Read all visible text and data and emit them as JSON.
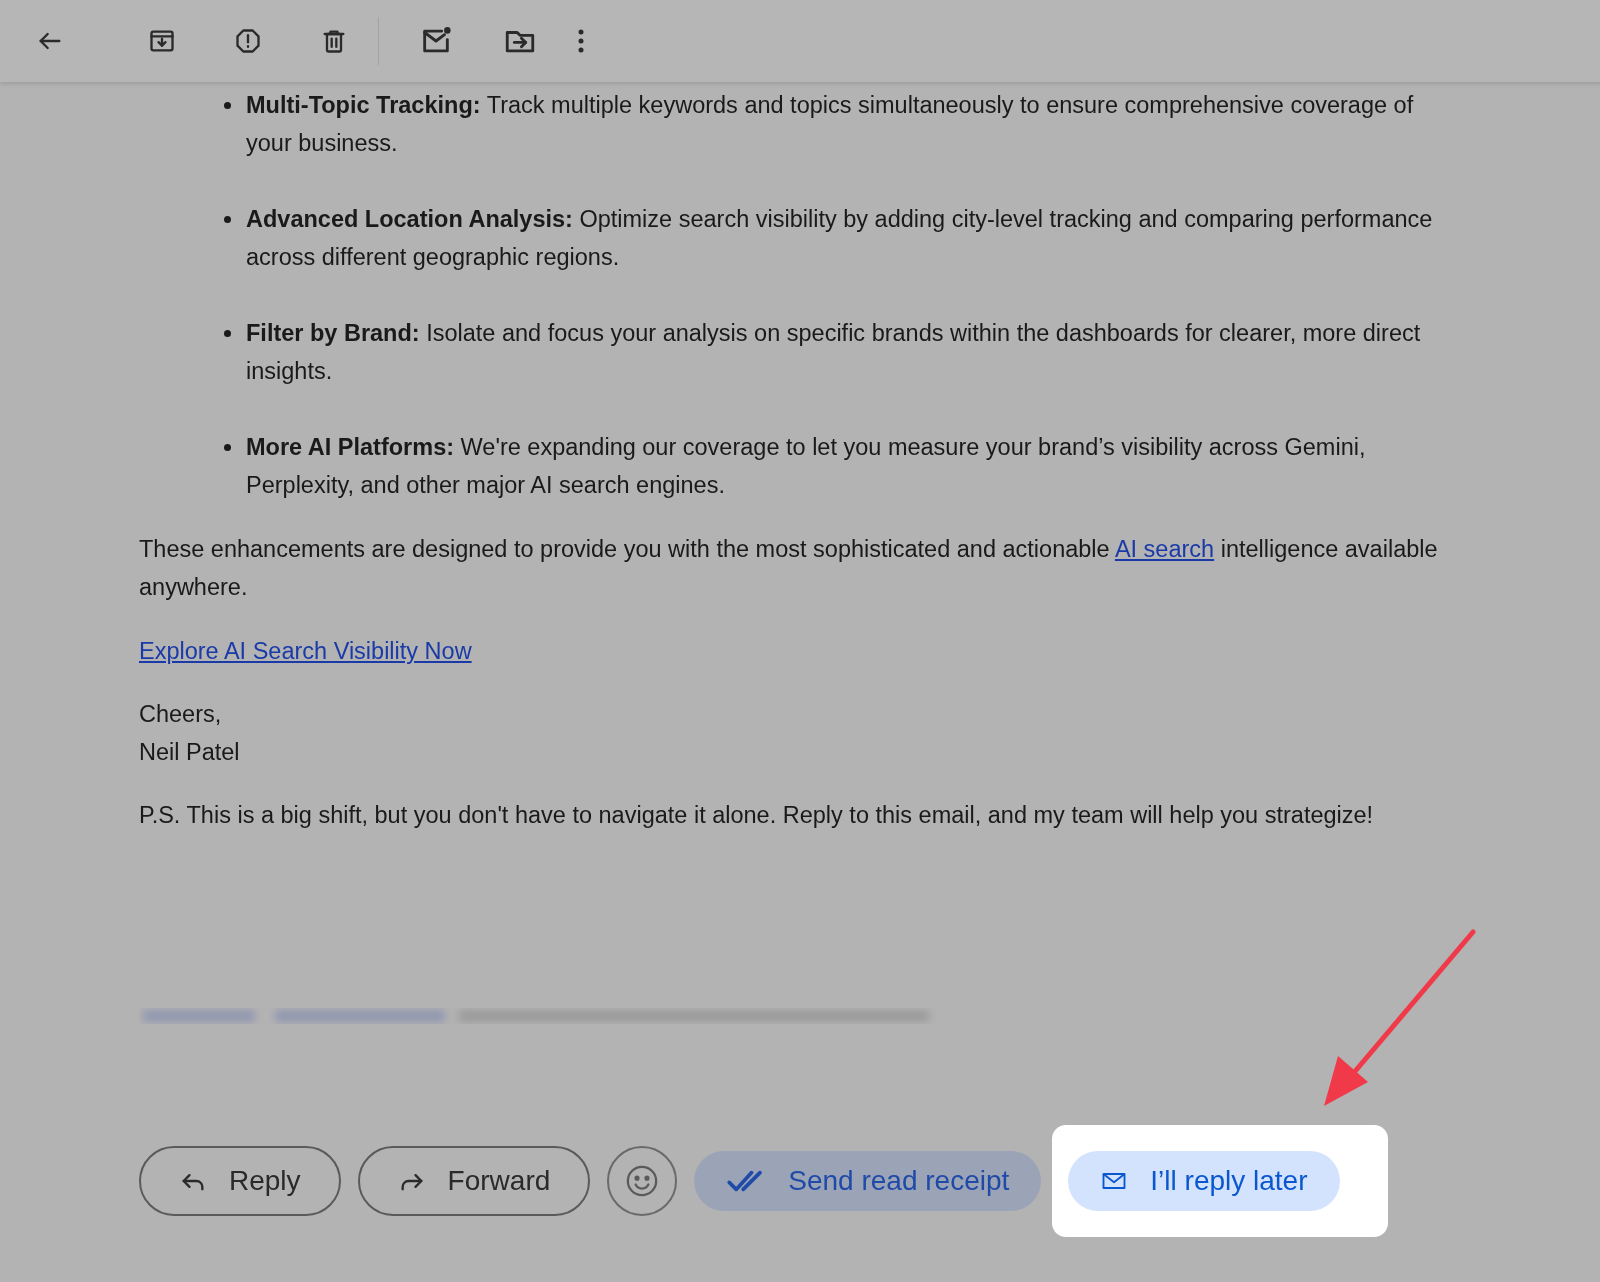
{
  "bullets": [
    {
      "title": "Multi-Topic Tracking:",
      "text": "Track multiple keywords and topics simultaneously to ensure comprehensive coverage of your business."
    },
    {
      "title": "Advanced Location Analysis:",
      "text": "Optimize search visibility by adding city-level tracking and comparing performance across different geographic regions."
    },
    {
      "title": "Filter by Brand:",
      "text": "Isolate and focus your analysis on specific brands within the dashboards for clearer, more direct insights."
    },
    {
      "title": "More AI Platforms:",
      "text": "We're expanding our coverage to let you measure your brand’s visibility across Gemini, Perplexity, and other major AI search engines."
    }
  ],
  "paragraph": {
    "before": "These enhancements are designed to provide you with the most sophisticated and actionable",
    "link": "AI search",
    "after": "intelligence available anywhere."
  },
  "cta_link": "Explore AI Search Visibility Now",
  "signoff": [
    "Cheers,",
    "Neil Patel"
  ],
  "postscript": "P.S. This is a big shift, but you don't have to navigate it alone. Reply to this email, and my team will help you strategize!",
  "actions": [
    {
      "kind": "reply",
      "label": "Reply"
    },
    {
      "kind": "forward",
      "label": "Forward"
    },
    {
      "kind": "emoji"
    },
    {
      "kind": "read_receipt",
      "label": "Send read receipt"
    },
    {
      "kind": "reply_later",
      "label": "I’ll reply later",
      "highlighted": true
    }
  ]
}
